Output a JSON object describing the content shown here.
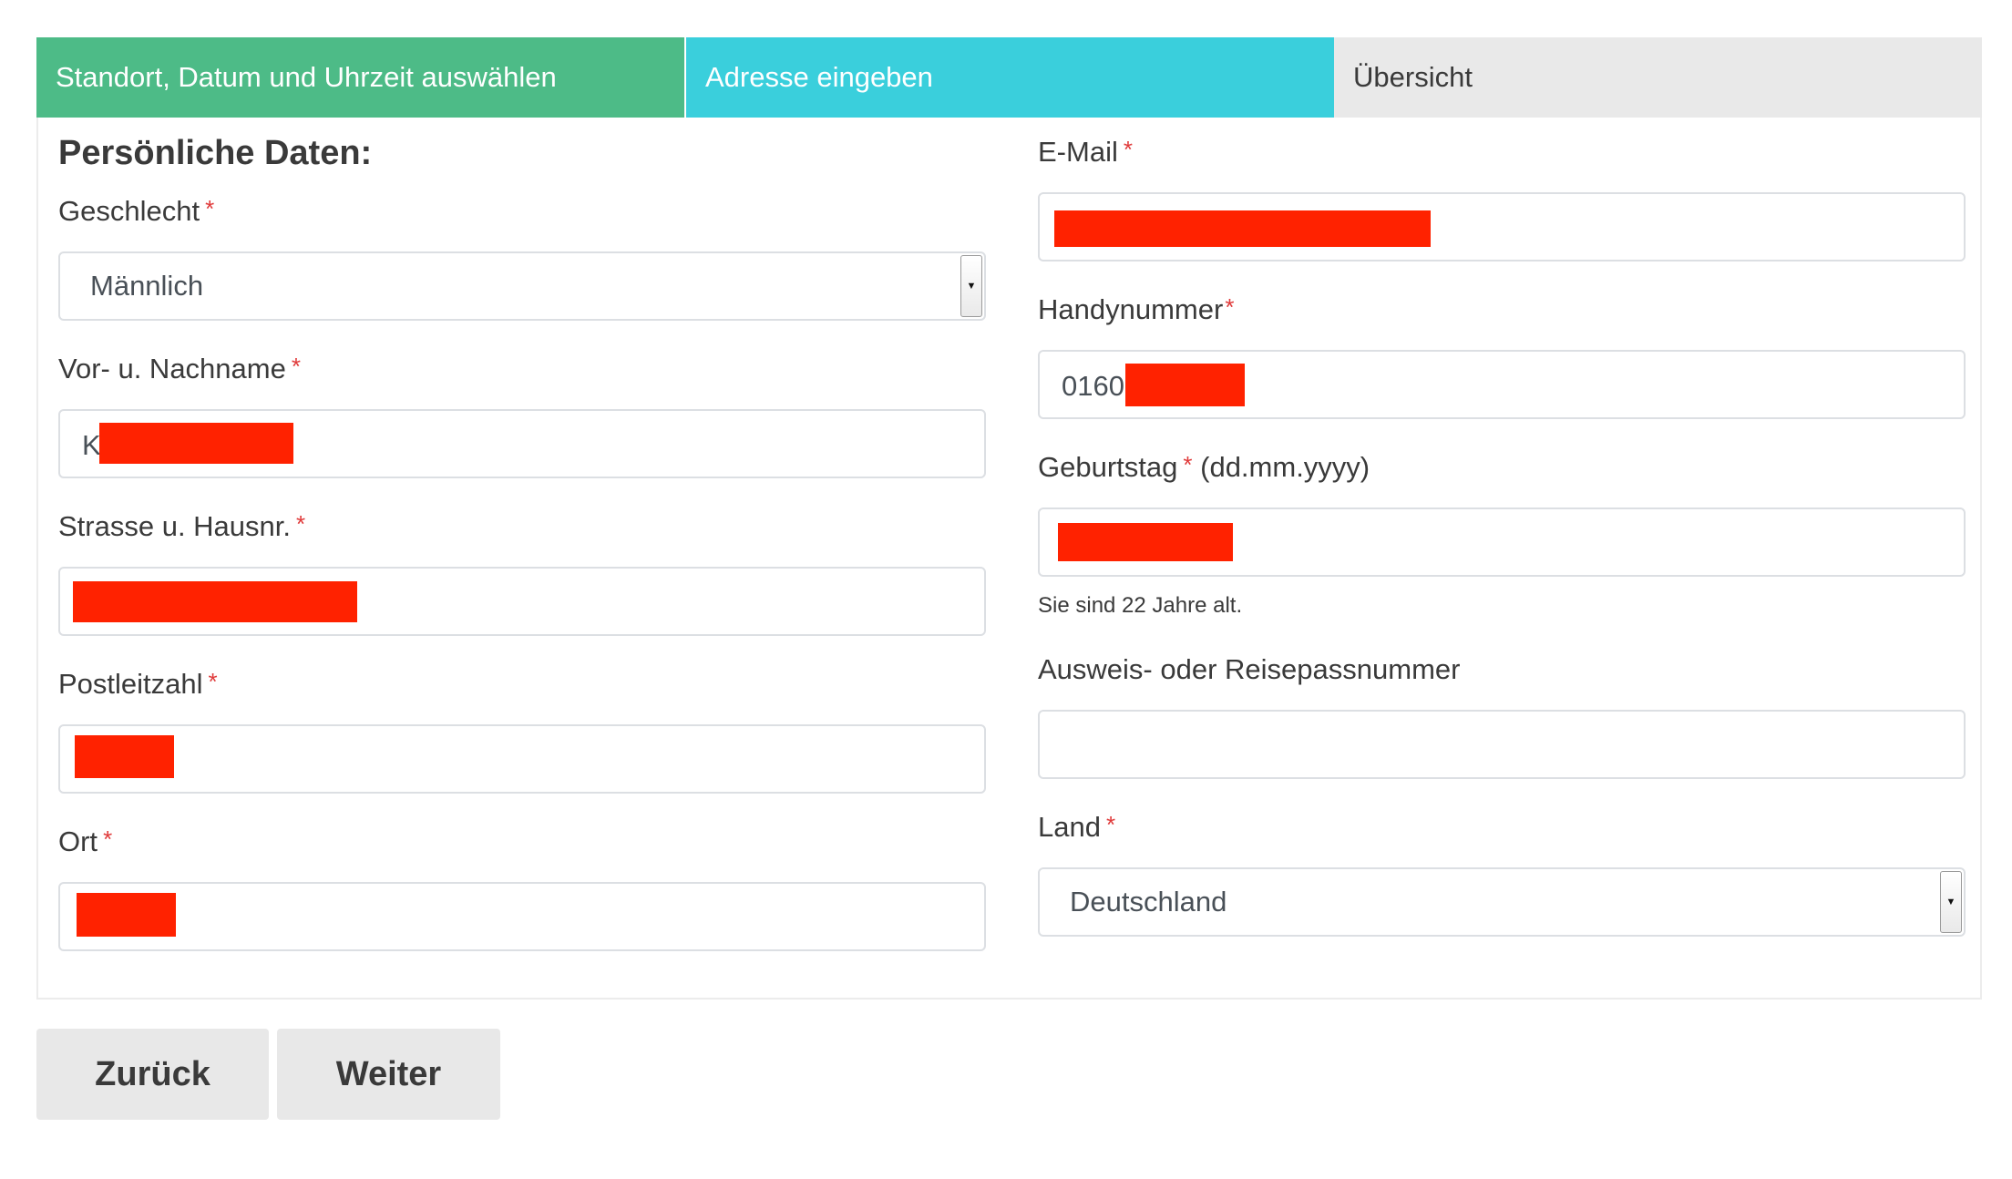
{
  "steps": [
    {
      "label": "Standort, Datum und Uhrzeit auswählen",
      "state": "completed",
      "color": "#4dbb87"
    },
    {
      "label": "Adresse eingeben",
      "state": "active",
      "color": "#3acfdc"
    },
    {
      "label": "Übersicht",
      "state": "pending",
      "color": "#e9e9e9"
    }
  ],
  "form": {
    "section_title": "Persönliche Daten:",
    "required_marker": "*",
    "gender": {
      "label": "Geschlecht",
      "value": "Männlich"
    },
    "name": {
      "label": "Vor- u. Nachname",
      "visible_prefix": "K"
    },
    "street": {
      "label": "Strasse u. Hausnr."
    },
    "zip": {
      "label": "Postleitzahl"
    },
    "city": {
      "label": "Ort"
    },
    "email": {
      "label": "E-Mail"
    },
    "phone": {
      "label": "Handynummer",
      "visible_prefix": "0160"
    },
    "birthday": {
      "label": "Geburtstag",
      "format_hint": "(dd.mm.yyyy)",
      "age_note": "Sie sind 22 Jahre alt."
    },
    "passport": {
      "label": "Ausweis- oder Reisepassnummer",
      "value": ""
    },
    "country": {
      "label": "Land",
      "value": "Deutschland"
    }
  },
  "buttons": {
    "back": "Zurück",
    "next": "Weiter"
  },
  "colors": {
    "required": "#e03a3a",
    "redaction": "#ff2200"
  }
}
